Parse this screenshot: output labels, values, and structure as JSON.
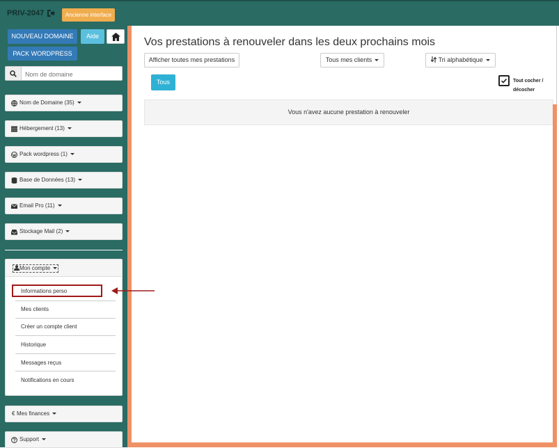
{
  "topbar": {
    "id": "PRIV-2047",
    "old_ui_label": "Ancienne interface"
  },
  "sidebar": {
    "new_domain_label": "NOUVEAU DOMAINE",
    "help_label": "Aide",
    "wordpress_label": "PACK WORDPRESS",
    "search_placeholder": "Nom de domaine",
    "menus": [
      {
        "label": "Nom de Domaine (35)",
        "icon": "globe-icon"
      },
      {
        "label": "Hébergement (13)",
        "icon": "server-icon"
      },
      {
        "label": "Pack wordpress (1)",
        "icon": "wordpress-icon"
      },
      {
        "label": "Base de Données (13)",
        "icon": "database-icon"
      },
      {
        "label": "Email Pro (11)",
        "icon": "envelope-icon"
      },
      {
        "label": "Stockage Mail (2)",
        "icon": "inbox-icon"
      }
    ],
    "account": {
      "title": "Mon compte",
      "items": [
        "Informations perso",
        "Mes clients",
        "Créer un compte client",
        "Historique",
        "Messages reçus",
        "Notifications en cours"
      ]
    },
    "finances_label": "Mes finances",
    "support_label": "Support"
  },
  "main": {
    "title": "Vos prestations à renouveler dans les deux prochains mois",
    "show_all_label": "Afficher toutes mes prestations",
    "clients_filter_label": "Tous mes clients",
    "sort_label": "Tri alphabétique",
    "all_button_label": "Tous",
    "check_all_label_line1": "Tout cocher /",
    "check_all_label_line2": "décocher",
    "empty_message": "Vous n'avez aucune prestation à renouveler"
  },
  "colors": {
    "sidebar": "#2a6b63",
    "accent": "#ef9166",
    "primary": "#337ab7",
    "info": "#5bc0de",
    "warning": "#f0ad4e",
    "highlight": "#a01818"
  }
}
